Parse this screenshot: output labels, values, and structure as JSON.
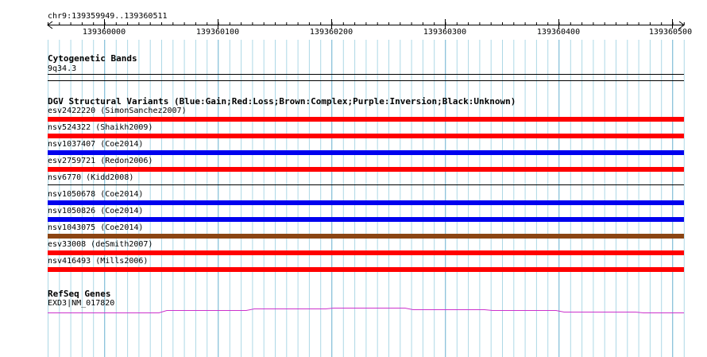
{
  "location": "chr9:139359949..139360511",
  "ruler": {
    "ticks": [
      "139360000",
      "139360100",
      "139360200",
      "139360300",
      "139360400",
      "139360500"
    ]
  },
  "cytoband_track": {
    "title": "Cytogenetic Bands",
    "band": "9q34.3"
  },
  "dgv_track": {
    "title": "DGV Structural Variants (Blue:Gain;Red:Loss;Brown:Complex;Purple:Inversion;Black:Unknown)",
    "variants": [
      {
        "label": "esv2422220 (SimonSanchez2007)",
        "type": "loss"
      },
      {
        "label": "nsv524322 (Shaikh2009)",
        "type": "loss"
      },
      {
        "label": "nsv1037407 (Coe2014)",
        "type": "gain"
      },
      {
        "label": "esv2759721 (Redon2006)",
        "type": "loss"
      },
      {
        "label": "nsv6770 (Kidd2008)",
        "type": "unknown"
      },
      {
        "label": "nsv1050678 (Coe2014)",
        "type": "gain"
      },
      {
        "label": "nsv1050826 (Coe2014)",
        "type": "gain"
      },
      {
        "label": "nsv1043075 (Coe2014)",
        "type": "complex"
      },
      {
        "label": "esv33008 (deSmith2007)",
        "type": "loss"
      },
      {
        "label": "nsv416493 (Mills2006)",
        "type": "loss"
      }
    ]
  },
  "refseq_track": {
    "title": "RefSeq Genes",
    "gene": "EXD3|NM_017820"
  },
  "colors": {
    "gain": "#0000ee",
    "loss": "#ff0000",
    "complex": "#8b4513",
    "inversion": "#800080",
    "unknown": "#000000",
    "grid": "#add8e6",
    "gene": "#cc33cc"
  }
}
